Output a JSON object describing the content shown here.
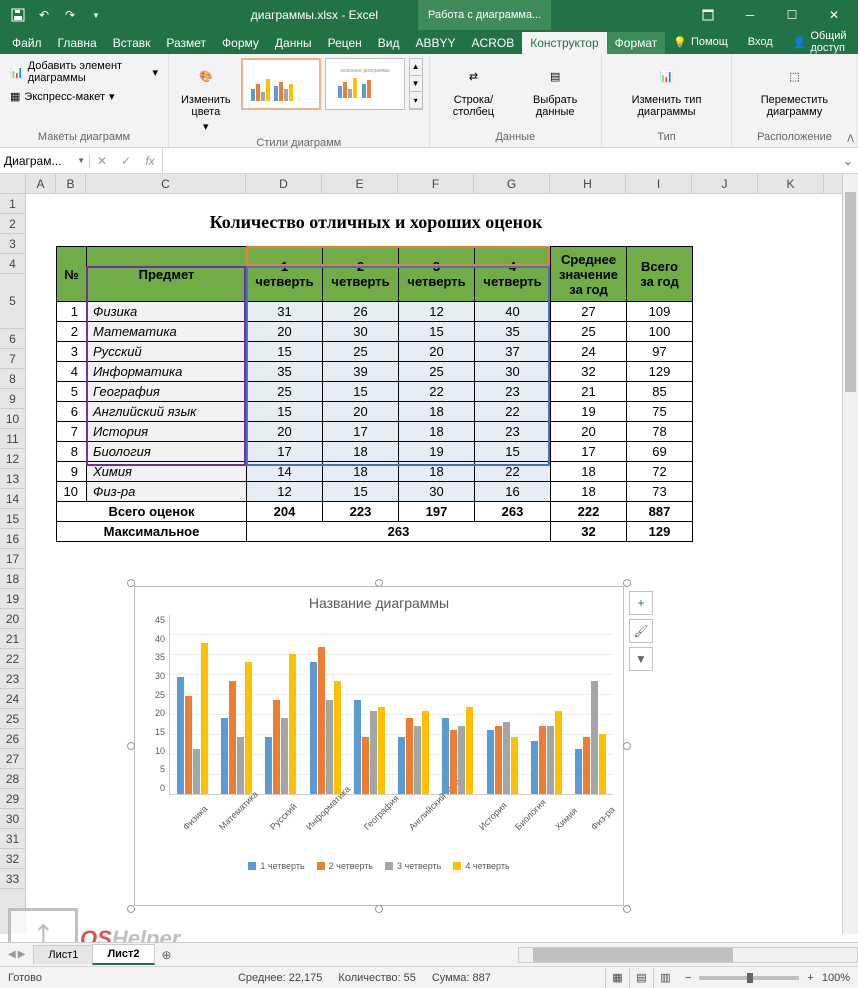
{
  "titlebar": {
    "filename": "диаграммы.xlsx - Excel",
    "chart_tools": "Работа с диаграмма..."
  },
  "tabs": {
    "file": "Файл",
    "home": "Главна",
    "insert": "Вставк",
    "layout": "Размет",
    "formulas": "Форму",
    "data": "Данны",
    "review": "Рецен",
    "view": "Вид",
    "abbyy": "ABBYY",
    "acrobat": "ACROB",
    "constructor": "Конструктор",
    "format": "Формат",
    "help": "Помощ",
    "login": "Вход",
    "share": "Общий доступ"
  },
  "ribbon": {
    "add_element": "Добавить элемент диаграммы",
    "express": "Экспресс-макет",
    "layouts_label": "Макеты диаграмм",
    "change_colors": "Изменить цвета",
    "styles_label": "Стили диаграмм",
    "switch_rc": "Строка/столбец",
    "select_data": "Выбрать данные",
    "data_label": "Данные",
    "change_type": "Изменить тип диаграммы",
    "type_label": "Тип",
    "move_chart": "Переместить диаграмму",
    "location_label": "Расположение"
  },
  "namebox": "Диаграм...",
  "table": {
    "title": "Количество отличных и хороших оценок",
    "headers": {
      "num": "№",
      "subject": "Предмет",
      "q1": "1 четверть",
      "q2": "2 четверть",
      "q3": "3 четверть",
      "q4": "4 четверть",
      "avg": "Среднее значение за год",
      "total": "Всего за год"
    },
    "rows": [
      {
        "n": 1,
        "s": "Физика",
        "q": [
          31,
          26,
          12,
          40
        ],
        "avg": 27,
        "tot": 109
      },
      {
        "n": 2,
        "s": "Математика",
        "q": [
          20,
          30,
          15,
          35
        ],
        "avg": 25,
        "tot": 100
      },
      {
        "n": 3,
        "s": "Русский",
        "q": [
          15,
          25,
          20,
          37
        ],
        "avg": 24,
        "tot": 97
      },
      {
        "n": 4,
        "s": "Информатика",
        "q": [
          35,
          39,
          25,
          30
        ],
        "avg": 32,
        "tot": 129
      },
      {
        "n": 5,
        "s": "География",
        "q": [
          25,
          15,
          22,
          23
        ],
        "avg": 21,
        "tot": 85
      },
      {
        "n": 6,
        "s": "Английский язык",
        "q": [
          15,
          20,
          18,
          22
        ],
        "avg": 19,
        "tot": 75
      },
      {
        "n": 7,
        "s": "История",
        "q": [
          20,
          17,
          18,
          23
        ],
        "avg": 20,
        "tot": 78
      },
      {
        "n": 8,
        "s": "Биология",
        "q": [
          17,
          18,
          19,
          15
        ],
        "avg": 17,
        "tot": 69
      },
      {
        "n": 9,
        "s": "Химия",
        "q": [
          14,
          18,
          18,
          22
        ],
        "avg": 18,
        "tot": 72
      },
      {
        "n": 10,
        "s": "Физ-ра",
        "q": [
          12,
          15,
          30,
          16
        ],
        "avg": 18,
        "tot": 73
      }
    ],
    "totals_label": "Всего оценок",
    "totals": {
      "q1": 204,
      "q2": 223,
      "q3": 197,
      "q4": 263,
      "avg": 222,
      "tot": 887
    },
    "max_label": "Максимальное",
    "max": {
      "q": 263,
      "avg": 32,
      "tot": 129
    }
  },
  "chart_data": {
    "type": "bar",
    "title": "Название диаграммы",
    "categories": [
      "Физика",
      "Математика",
      "Русский",
      "Информатика",
      "География",
      "Английский язык",
      "История",
      "Биология",
      "Химия",
      "Физ-ра"
    ],
    "series": [
      {
        "name": "1 четверть",
        "values": [
          31,
          20,
          15,
          35,
          25,
          15,
          20,
          17,
          14,
          12
        ]
      },
      {
        "name": "2 четверть",
        "values": [
          26,
          30,
          25,
          39,
          15,
          20,
          17,
          18,
          18,
          15
        ]
      },
      {
        "name": "3 четверть",
        "values": [
          12,
          15,
          20,
          25,
          22,
          18,
          18,
          19,
          18,
          30
        ]
      },
      {
        "name": "4 четверть",
        "values": [
          40,
          35,
          37,
          30,
          23,
          22,
          23,
          15,
          22,
          16
        ]
      }
    ],
    "ylim": [
      0,
      45
    ],
    "yticks": [
      0,
      5,
      10,
      15,
      20,
      25,
      30,
      35,
      40,
      45
    ]
  },
  "sheets": {
    "s1": "Лист1",
    "s2": "Лист2"
  },
  "status": {
    "ready": "Готово",
    "avg": "Среднее: 22,175",
    "count": "Количество: 55",
    "sum": "Сумма: 887",
    "zoom": "100%"
  },
  "watermark": "OSHelper"
}
